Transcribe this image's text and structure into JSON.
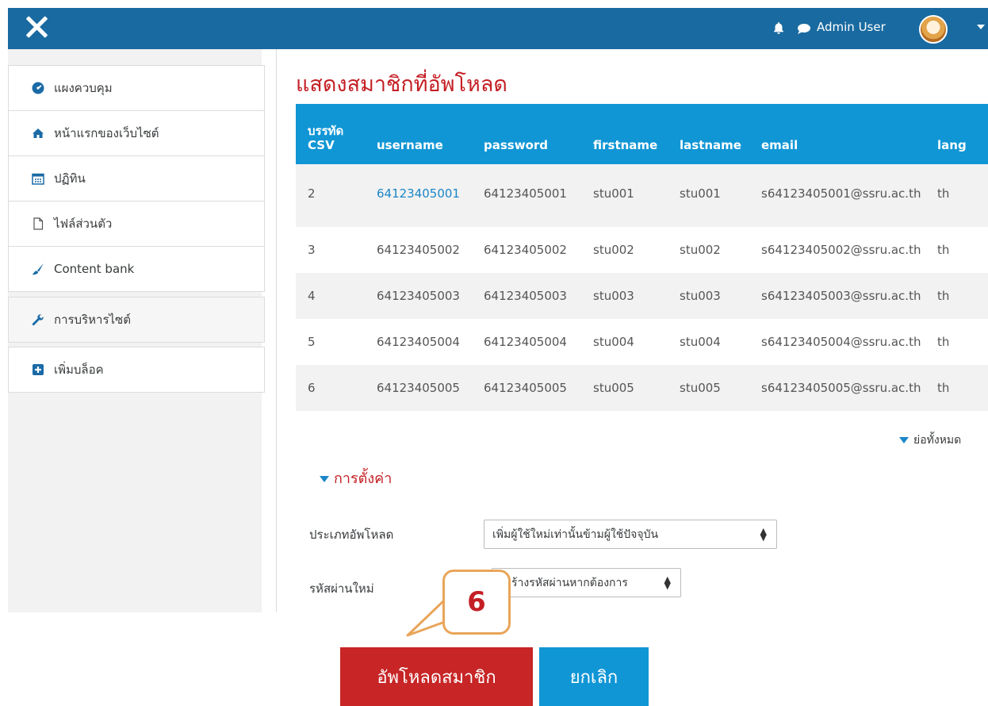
{
  "header": {
    "close_icon": "close-icon",
    "user_name": "Admin User",
    "icons": [
      "bell-icon",
      "chat-icon",
      "avatar",
      "caret-down-icon"
    ]
  },
  "sidebar": {
    "items": [
      {
        "label": "แผงควบคุม",
        "icon": "dashboard-icon"
      },
      {
        "label": "หน้าแรกของเว็บไซต์",
        "icon": "home-icon"
      },
      {
        "label": "ปฏิทิน",
        "icon": "calendar-icon"
      },
      {
        "label": "ไฟล์ส่วนตัว",
        "icon": "file-icon"
      },
      {
        "label": "Content bank",
        "icon": "paintbrush-icon"
      },
      {
        "label": "การบริหารไซต์",
        "icon": "wrench-icon"
      },
      {
        "label": "เพิ่มบล็อค",
        "icon": "plus-square-icon"
      }
    ]
  },
  "main": {
    "title": "แสดงสมาชิกที่อัพโหลด",
    "table": {
      "columns": [
        "บรรทัด CSV",
        "username",
        "password",
        "firstname",
        "lastname",
        "email",
        "lang"
      ],
      "rows": [
        [
          "2",
          "64123405001",
          "64123405001",
          "stu001",
          "stu001",
          "s64123405001@ssru.ac.th",
          "th"
        ],
        [
          "3",
          "64123405002",
          "64123405002",
          "stu002",
          "stu002",
          "s64123405002@ssru.ac.th",
          "th"
        ],
        [
          "4",
          "64123405003",
          "64123405003",
          "stu003",
          "stu003",
          "s64123405003@ssru.ac.th",
          "th"
        ],
        [
          "5",
          "64123405004",
          "64123405004",
          "stu004",
          "stu004",
          "s64123405004@ssru.ac.th",
          "th"
        ],
        [
          "6",
          "64123405005",
          "64123405005",
          "stu005",
          "stu005",
          "s64123405005@ssru.ac.th",
          "th"
        ]
      ]
    },
    "collapse_all": "ย่อทั้งหมด",
    "settings": {
      "heading": "การตั้งค่า",
      "upload_type_label": "ประเภทอัพโหลด",
      "upload_type_value": "เพิ่มผู้ใช้ใหม่เท่านั้นข้ามผู้ใช้ปัจจุบัน",
      "new_password_label": "รหัสผ่านใหม่",
      "new_password_value": "ร้างรหัสผ่านหากต้องการ"
    },
    "buttons": {
      "upload": "อัพโหลดสมาชิก",
      "cancel": "ยกเลิก"
    }
  },
  "annotation": {
    "step_number": "6",
    "border_color": "#e9a559"
  },
  "colors": {
    "header": "#196aa0",
    "accent_red": "#c41f24",
    "table_header": "#1196d5",
    "link": "#1a86c8"
  }
}
